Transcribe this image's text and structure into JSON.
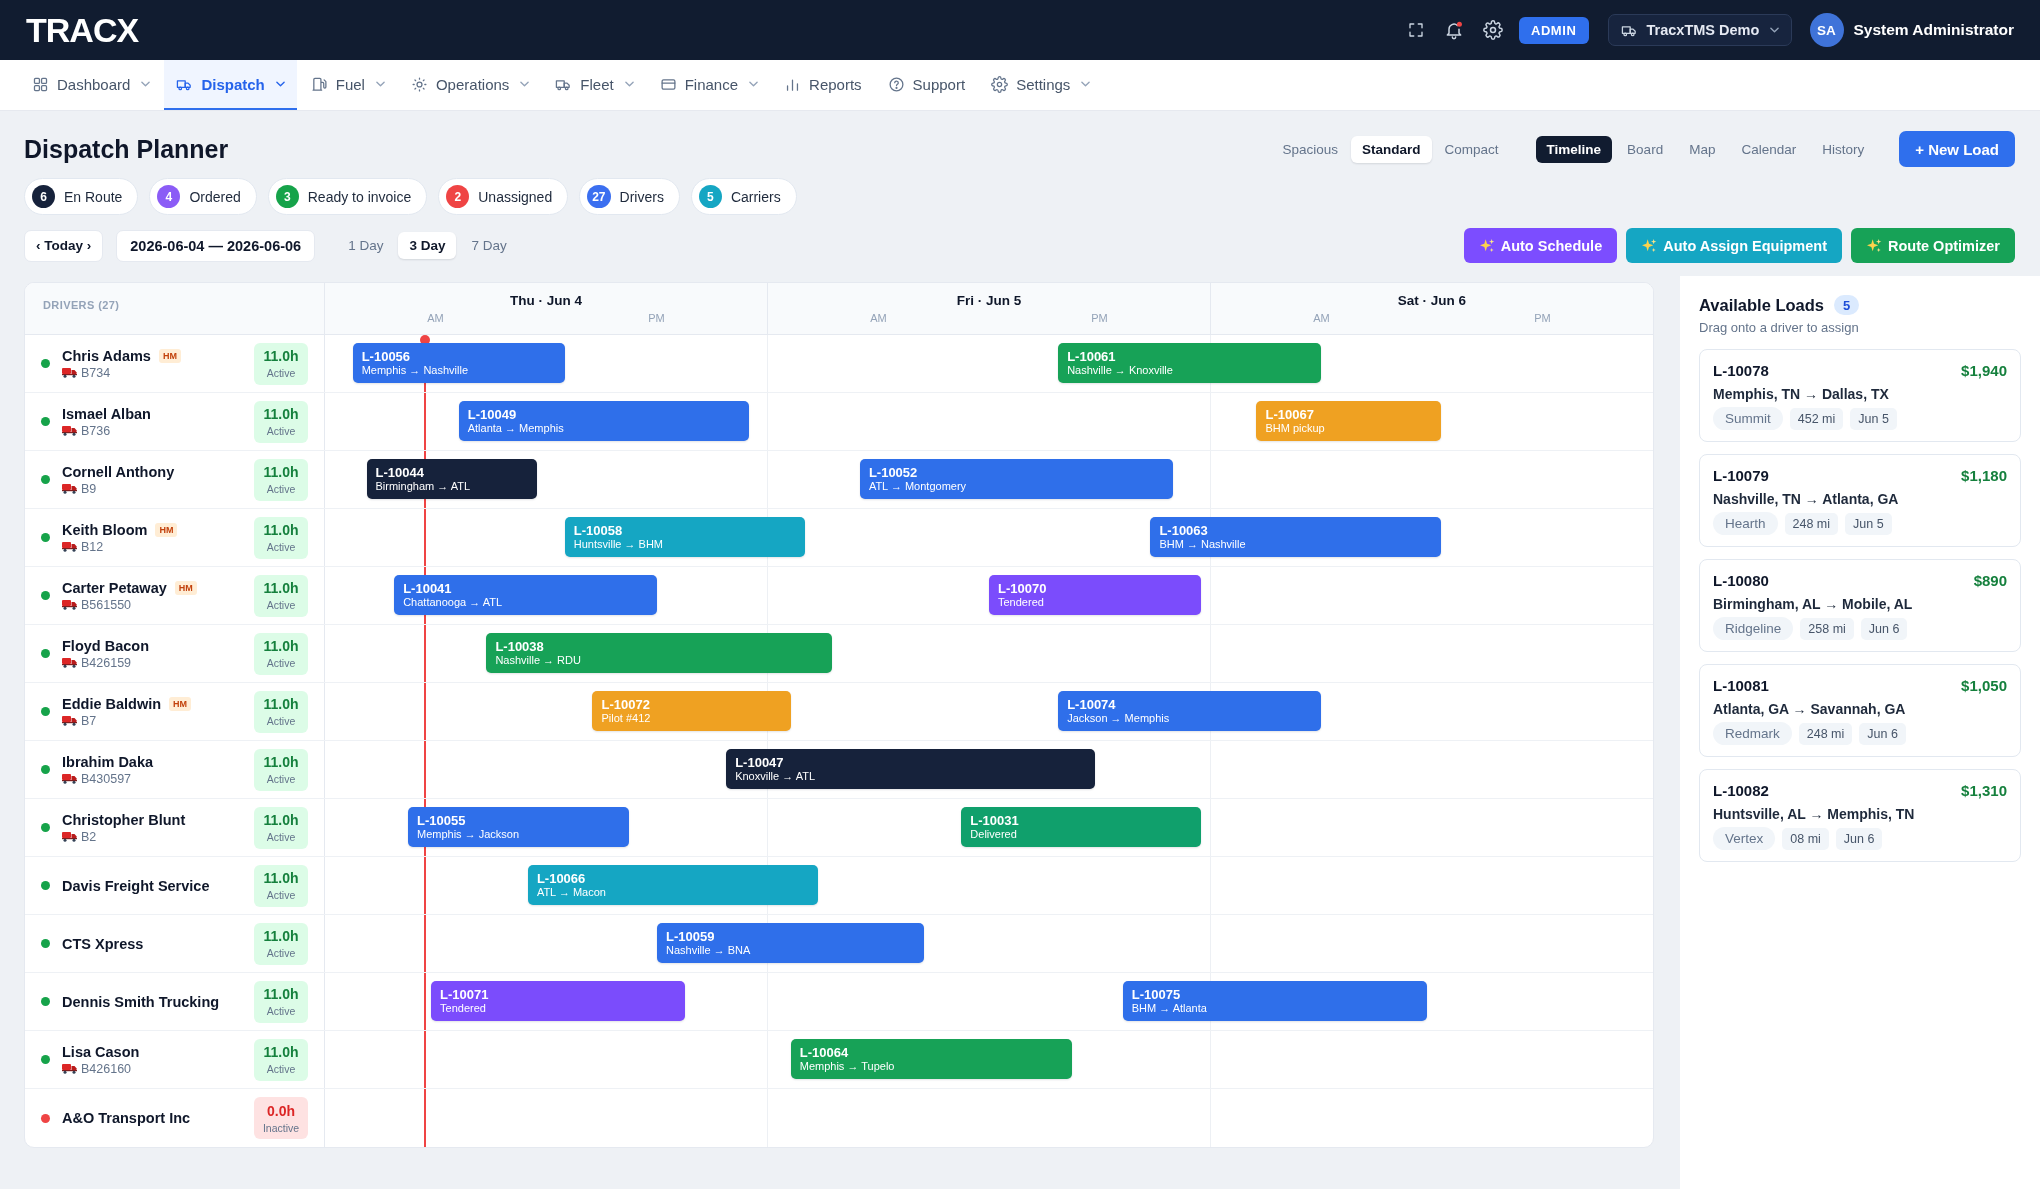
{
  "top_bar": {
    "logo": "TRACX",
    "notifications": true,
    "role": "ADMIN",
    "company": "TracxTMS Demo",
    "avatar": "SA",
    "user": "System Administrator"
  },
  "nav": [
    {
      "label": "Dashboard",
      "selected": false,
      "dropdown": true
    },
    {
      "label": "Dispatch",
      "selected": true,
      "dropdown": true
    },
    {
      "label": "Fuel",
      "selected": false,
      "dropdown": true
    },
    {
      "label": "Operations",
      "selected": false,
      "dropdown": true
    },
    {
      "label": "Fleet",
      "selected": false,
      "dropdown": true
    },
    {
      "label": "Finance",
      "selected": false,
      "dropdown": true
    },
    {
      "label": "Reports",
      "selected": false,
      "dropdown": false
    },
    {
      "label": "Support",
      "selected": false,
      "dropdown": false
    },
    {
      "label": "Settings",
      "selected": false,
      "dropdown": true
    }
  ],
  "page": {
    "title": "Dispatch Planner",
    "new_button": "+ New Load"
  },
  "density": [
    {
      "label": "Spacious",
      "selected": false
    },
    {
      "label": "Standard",
      "selected": true
    },
    {
      "label": "Compact",
      "selected": false
    }
  ],
  "views": [
    {
      "label": "Timeline",
      "selected": true
    },
    {
      "label": "Board",
      "selected": false
    },
    {
      "label": "Map",
      "selected": false
    },
    {
      "label": "Calendar",
      "selected": false
    },
    {
      "label": "History",
      "selected": false
    }
  ],
  "status_chips": [
    {
      "count": "6",
      "label": "En Route",
      "color": "#16223b"
    },
    {
      "count": "4",
      "label": "Ordered",
      "color": "#8b5cf6"
    },
    {
      "count": "3",
      "label": "Ready to invoice",
      "color": "#16a34a"
    },
    {
      "count": "2",
      "label": "Unassigned",
      "color": "#ef4444"
    },
    {
      "count": "27",
      "label": "Drivers",
      "color": "#3b6ff0"
    },
    {
      "count": "5",
      "label": "Carriers",
      "color": "#15a6c3"
    }
  ],
  "date_nav": {
    "today": "‹ Today ›",
    "range": "2026-06-04 — 2026-06-06"
  },
  "spans": [
    {
      "label": "1 Day",
      "selected": false
    },
    {
      "label": "3 Day",
      "selected": true
    },
    {
      "label": "7 Day",
      "selected": false
    }
  ],
  "actions": [
    {
      "label": "Auto Schedule",
      "color": "#7c4dff"
    },
    {
      "label": "Auto Assign Equipment",
      "color": "#15a6c3"
    },
    {
      "label": "Route Optimizer",
      "color": "#17a257"
    }
  ],
  "timeline": {
    "column_title": "DRIVERS (27)",
    "days": [
      {
        "label": "Thu · Jun 4",
        "periods": [
          "AM",
          "PM"
        ]
      },
      {
        "label": "Fri · Jun 5",
        "periods": [
          "AM",
          "PM"
        ]
      },
      {
        "label": "Sat · Jun 6",
        "periods": [
          "AM",
          "PM"
        ]
      }
    ],
    "drivers": [
      {
        "name": "Chris Adams",
        "badge": "HM",
        "unit": "B734",
        "hours": "11.0h",
        "status": "Active",
        "active": true,
        "loads": [
          {
            "id": "L-10056",
            "route": "Memphis → Nashville",
            "color": "#2f6fea"
          },
          {
            "id": "L-10061",
            "route": "Nashville → Knoxville",
            "color": "#17a257"
          }
        ]
      },
      {
        "name": "Ismael Alban",
        "unit": "B736",
        "hours": "11.0h",
        "status": "Active",
        "active": true,
        "loads": [
          {
            "id": "L-10049",
            "route": "Atlanta → Memphis",
            "color": "#2f6fea"
          },
          {
            "id": "L-10067",
            "route": "BHM pickup",
            "color": "#efa122"
          }
        ]
      },
      {
        "name": "Cornell Anthony",
        "unit": "B9",
        "hours": "11.0h",
        "status": "Active",
        "active": true,
        "loads": [
          {
            "id": "L-10044",
            "route": "Birmingham → ATL",
            "color": "#16223b"
          },
          {
            "id": "L-10052",
            "route": "ATL → Montgomery",
            "color": "#2f6fea"
          }
        ]
      },
      {
        "name": "Keith Bloom",
        "badge": "HM",
        "unit": "B12",
        "hours": "11.0h",
        "status": "Active",
        "active": true,
        "loads": [
          {
            "id": "L-10058",
            "route": "Huntsville → BHM",
            "color": "#15a6c3"
          },
          {
            "id": "L-10063",
            "route": "BHM → Nashville",
            "color": "#2f6fea"
          }
        ]
      },
      {
        "name": "Carter Petaway",
        "badge": "HM",
        "unit": "B561550",
        "hours": "11.0h",
        "status": "Active",
        "active": true,
        "loads": [
          {
            "id": "L-10041",
            "route": "Chattanooga → ATL",
            "color": "#2f6fea"
          },
          {
            "id": "L-10070",
            "route": "Tendered",
            "color": "#7b4cfc"
          }
        ]
      },
      {
        "name": "Floyd Bacon",
        "unit": "B426159",
        "hours": "11.0h",
        "status": "Active",
        "active": true,
        "loads": [
          {
            "id": "L-10038",
            "route": "Nashville → RDU",
            "color": "#17a257"
          }
        ]
      },
      {
        "name": "Eddie Baldwin",
        "badge": "HM",
        "unit": "B7",
        "hours": "11.0h",
        "status": "Active",
        "active": true,
        "loads": [
          {
            "id": "L-10072",
            "route": "Pilot #412",
            "color": "#efa122"
          },
          {
            "id": "L-10074",
            "route": "Jackson → Memphis",
            "color": "#2f6fea"
          }
        ]
      },
      {
        "name": "Ibrahim Daka",
        "unit": "B430597",
        "hours": "11.0h",
        "status": "Active",
        "active": true,
        "loads": [
          {
            "id": "L-10047",
            "route": "Knoxville → ATL",
            "color": "#16223b"
          }
        ]
      },
      {
        "name": "Christopher Blunt",
        "unit": "B2",
        "hours": "11.0h",
        "status": "Active",
        "active": true,
        "loads": [
          {
            "id": "L-10055",
            "route": "Memphis → Jackson",
            "color": "#2f6fea"
          },
          {
            "id": "L-10031",
            "route": "Delivered",
            "color": "#10a06c"
          }
        ]
      },
      {
        "name": "Davis Freight Service",
        "hours": "11.0h",
        "status": "Active",
        "active": true,
        "loads": [
          {
            "id": "L-10066",
            "route": "ATL → Macon",
            "color": "#15a6c3"
          }
        ]
      },
      {
        "name": "CTS Xpress",
        "hours": "11.0h",
        "status": "Active",
        "active": true,
        "loads": [
          {
            "id": "L-10059",
            "route": "Nashville → BNA",
            "color": "#2f6fea"
          }
        ]
      },
      {
        "name": "Dennis Smith Trucking",
        "hours": "11.0h",
        "status": "Active",
        "active": true,
        "loads": [
          {
            "id": "L-10071",
            "route": "Tendered",
            "color": "#7b4cfc"
          },
          {
            "id": "L-10075",
            "route": "BHM → Atlanta",
            "color": "#2f6fea"
          }
        ]
      },
      {
        "name": "Lisa Cason",
        "unit": "B426160",
        "hours": "11.0h",
        "status": "Active",
        "active": true,
        "loads": [
          {
            "id": "L-10064",
            "route": "Memphis → Tupelo",
            "color": "#17a257"
          }
        ]
      },
      {
        "name": "A&O Transport Inc",
        "hours": "0.0h",
        "status": "Inactive",
        "active": false
      }
    ]
  },
  "available_loads": {
    "title": "Available Loads",
    "count": "5",
    "subtitle": "Drag onto a driver to assign",
    "loads": [
      {
        "id": "L-10078",
        "price": "$1,940",
        "route": "Memphis, TN → Dallas, TX",
        "company": "Summit",
        "miles": "452 mi",
        "date": "Jun 5"
      },
      {
        "id": "L-10079",
        "price": "$1,180",
        "route": "Nashville, TN → Atlanta, GA",
        "company": "Hearth",
        "miles": "248 mi",
        "date": "Jun 5"
      },
      {
        "id": "L-10080",
        "price": "$890",
        "route": "Birmingham, AL → Mobile, AL",
        "company": "Ridgeline",
        "miles": "258 mi",
        "date": "Jun 6"
      },
      {
        "id": "L-10081",
        "price": "$1,050",
        "route": "Atlanta, GA → Savannah, GA",
        "company": "Redmark",
        "miles": "248 mi",
        "date": "Jun 6"
      },
      {
        "id": "L-10082",
        "price": "$1,310",
        "route": "Huntsville, AL → Memphis, TN",
        "company": "Vertex",
        "miles": "08 mi",
        "date": "Jun 6"
      }
    ]
  }
}
